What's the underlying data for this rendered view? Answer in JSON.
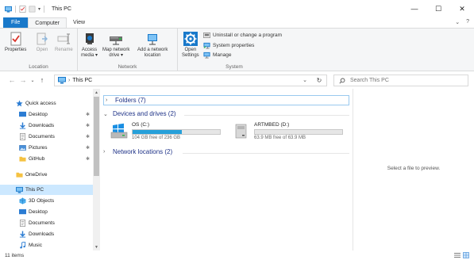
{
  "window": {
    "title": "This PC",
    "minimize": "—",
    "maximize": "☐",
    "close": "✕"
  },
  "tabs": {
    "file": "File",
    "computer": "Computer",
    "view": "View",
    "collapse": "⌄",
    "help": "?"
  },
  "ribbon": {
    "location": {
      "label": "Location",
      "properties": "Properties",
      "open": "Open",
      "rename": "Rename"
    },
    "network": {
      "label": "Network",
      "access_media_1": "Access",
      "access_media_2": "media ▾",
      "map_drive_1": "Map network",
      "map_drive_2": "drive ▾",
      "add_location_1": "Add a network",
      "add_location_2": "location"
    },
    "system": {
      "label": "System",
      "open_settings_1": "Open",
      "open_settings_2": "Settings",
      "uninstall": "Uninstall or change a program",
      "system_properties": "System properties",
      "manage": "Manage"
    }
  },
  "address": {
    "back": "←",
    "forward": "→",
    "recent": "⌄",
    "up": "↑",
    "path": "This PC",
    "dropdown": "⌄",
    "refresh": "↻",
    "search_placeholder": "Search This PC"
  },
  "nav": {
    "items": [
      {
        "label": "Quick access",
        "pinned": false
      },
      {
        "label": "Desktop",
        "pinned": true
      },
      {
        "label": "Downloads",
        "pinned": true
      },
      {
        "label": "Documents",
        "pinned": true
      },
      {
        "label": "Pictures",
        "pinned": true
      },
      {
        "label": "GitHub",
        "pinned": true
      },
      {
        "label": "OneDrive",
        "pinned": false
      },
      {
        "label": "This PC",
        "pinned": false
      },
      {
        "label": "3D Objects",
        "pinned": false
      },
      {
        "label": "Desktop",
        "pinned": false
      },
      {
        "label": "Documents",
        "pinned": false
      },
      {
        "label": "Downloads",
        "pinned": false
      },
      {
        "label": "Music",
        "pinned": false
      }
    ],
    "pin_glyph": "✱"
  },
  "content": {
    "folders_header": "Folders (7)",
    "devices_header": "Devices and drives (2)",
    "network_header": "Network locations (2)",
    "drives": [
      {
        "name": "OS (C:)",
        "free": "104 GB free of 236 GB",
        "used_fraction": 0.56
      },
      {
        "name": "ARTMBED (D:)",
        "free": "63.9 MB free of 63.9 MB",
        "used_fraction": 0.0
      }
    ]
  },
  "preview": {
    "text": "Select a file to preview."
  },
  "status": {
    "items": "11 items"
  },
  "colors": {
    "accent": "#1979ca",
    "selection": "#cce8ff",
    "drive_bar": "#26a0da",
    "group_header": "#1e3287"
  }
}
